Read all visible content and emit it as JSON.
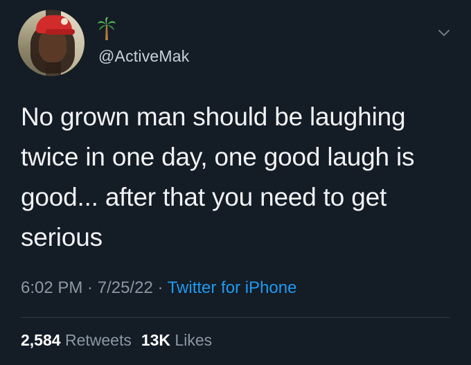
{
  "tweet": {
    "handle": "@ActiveMak",
    "emoji": "palm-tree-icon",
    "text": "No grown man should be laughing\ntwice in one day, one good laugh is\ngood... after that you need to get\nserious",
    "time": "6:02 PM",
    "separator": " · ",
    "date": "7/25/22",
    "source": "Twitter for iPhone",
    "retweets_count": "2,584",
    "retweets_label": "Retweets",
    "likes_count": "13K",
    "likes_label": "Likes"
  },
  "colors": {
    "background": "#141c26",
    "text": "#f1f3f5",
    "secondary": "#8b98a5",
    "link": "#1d9bf0"
  }
}
